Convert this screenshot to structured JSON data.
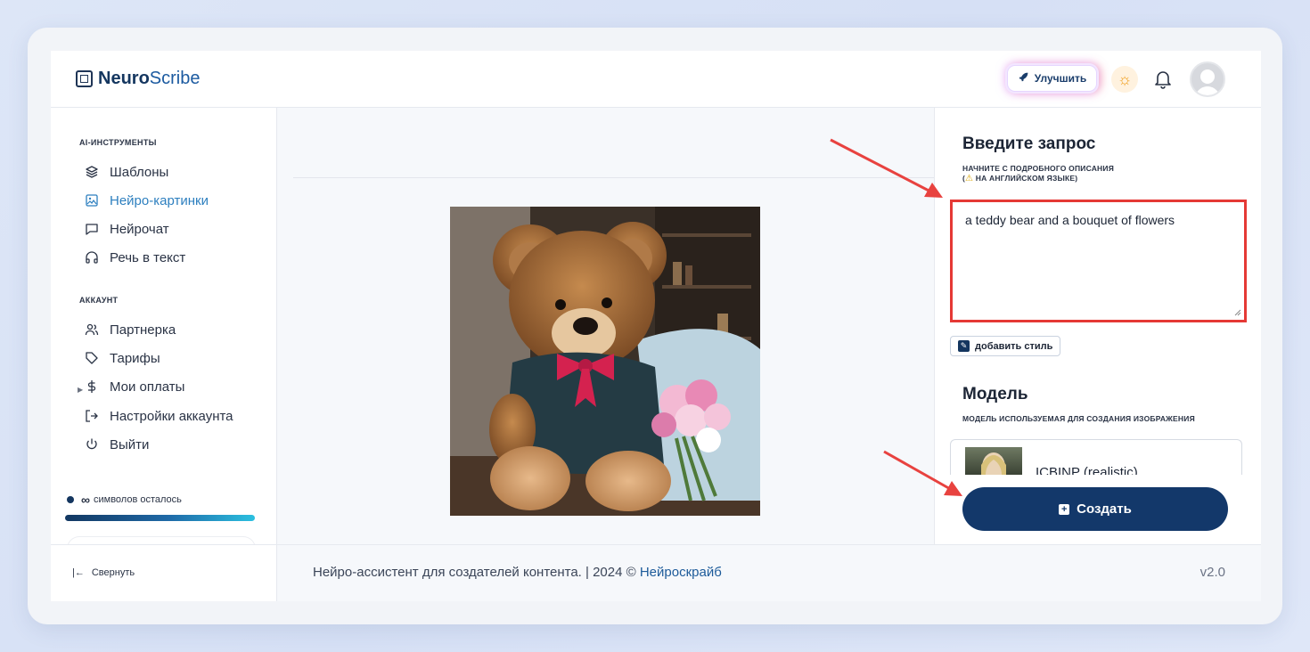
{
  "header": {
    "logo_bold": "Neuro",
    "logo_rest": "Scribe",
    "upgrade_label": "Улучшить"
  },
  "sidebar": {
    "section_tools": "AI-ИНСТРУМЕНТЫ",
    "tools": [
      {
        "label": "Шаблоны",
        "icon": "layers-icon"
      },
      {
        "label": "Нейро-картинки",
        "icon": "image-icon",
        "active": true
      },
      {
        "label": "Нейрочат",
        "icon": "chat-icon"
      },
      {
        "label": "Речь в текст",
        "icon": "headphones-icon"
      }
    ],
    "section_account": "АККАУНТ",
    "account": [
      {
        "label": "Партнерка",
        "icon": "users-icon"
      },
      {
        "label": "Тарифы",
        "icon": "tag-icon"
      },
      {
        "label": "Мои оплаты",
        "icon": "dollar-icon"
      },
      {
        "label": "Настройки аккаунта",
        "icon": "logout-arrow-icon"
      },
      {
        "label": "Выйти",
        "icon": "power-icon"
      }
    ],
    "credits_symbol": "∞",
    "credits_text": "символов осталось",
    "collapse_label": "Свернуть"
  },
  "panel": {
    "prompt_title": "Введите запрос",
    "prompt_hint_line1": "НАЧНИТЕ С ПОДРОБНОГО ОПИСАНИЯ",
    "prompt_hint_line2": "НА АНГЛИЙСКОМ ЯЗЫКЕ)",
    "prompt_value": "a teddy bear and a bouquet of flowers",
    "style_button": "добавить стиль",
    "model_title": "Модель",
    "model_hint": "МОДЕЛЬ ИСПОЛЬЗУЕМАЯ ДЛЯ СОЗДАНИЯ ИЗОБРАЖЕНИЯ",
    "model_name": "ICBINP (realistic)",
    "create_button": "Создать"
  },
  "footer": {
    "text": "Нейро-ассистент для создателей контента.  | 2024 © ",
    "link": "Нейроскрайб",
    "version": "v2.0"
  },
  "colors": {
    "brand": "#13386a",
    "active": "#2d7fbf",
    "highlight": "#e53935"
  }
}
